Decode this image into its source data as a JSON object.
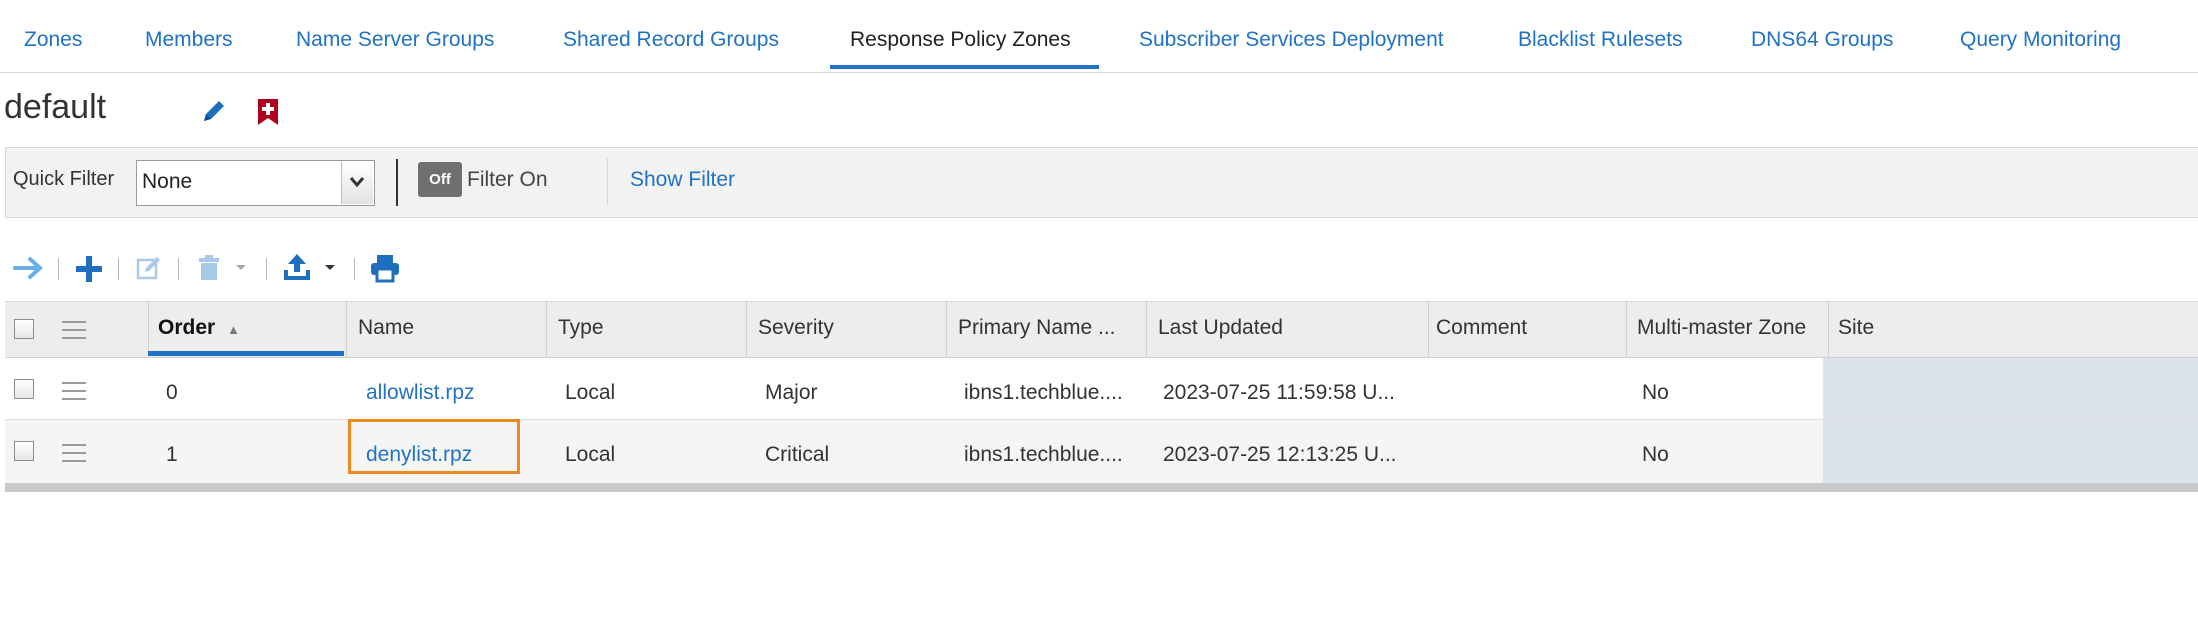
{
  "tabs": [
    {
      "label": "Zones"
    },
    {
      "label": "Members"
    },
    {
      "label": "Name Server Groups"
    },
    {
      "label": "Shared Record Groups"
    },
    {
      "label": "Response Policy Zones",
      "active": true
    },
    {
      "label": "Subscriber Services Deployment"
    },
    {
      "label": "Blacklist Rulesets"
    },
    {
      "label": "DNS64 Groups"
    },
    {
      "label": "Query Monitoring"
    }
  ],
  "page": {
    "title": "default"
  },
  "filter": {
    "quick_filter_label": "Quick Filter",
    "quick_filter_value": "None",
    "toggle_label": "Off",
    "filter_on_label": "Filter On",
    "show_filter_label": "Show Filter"
  },
  "toolbar": {
    "icons": [
      "arrow-right-icon",
      "add-icon",
      "edit-icon",
      "delete-icon",
      "export-icon",
      "print-icon"
    ]
  },
  "grid": {
    "columns": [
      "Order",
      "Name",
      "Type",
      "Severity",
      "Primary Name ...",
      "Last Updated",
      "Comment",
      "Multi-master Zone",
      "Site"
    ],
    "sort_indicator": "▲",
    "rows": [
      {
        "order": "0",
        "name": "allowlist.rpz",
        "type": "Local",
        "severity": "Major",
        "primary": "ibns1.techblue....",
        "updated": "2023-07-25 11:59:58 U...",
        "comment": "",
        "multimaster": "No",
        "site": ""
      },
      {
        "order": "1",
        "name": "denylist.rpz",
        "type": "Local",
        "severity": "Critical",
        "primary": "ibns1.techblue....",
        "updated": "2023-07-25 12:13:25 U...",
        "comment": "",
        "multimaster": "No",
        "site": ""
      }
    ]
  },
  "colors": {
    "link": "#1f72c6",
    "highlight": "#ef8a1e",
    "delete_icon": "#b00020"
  }
}
